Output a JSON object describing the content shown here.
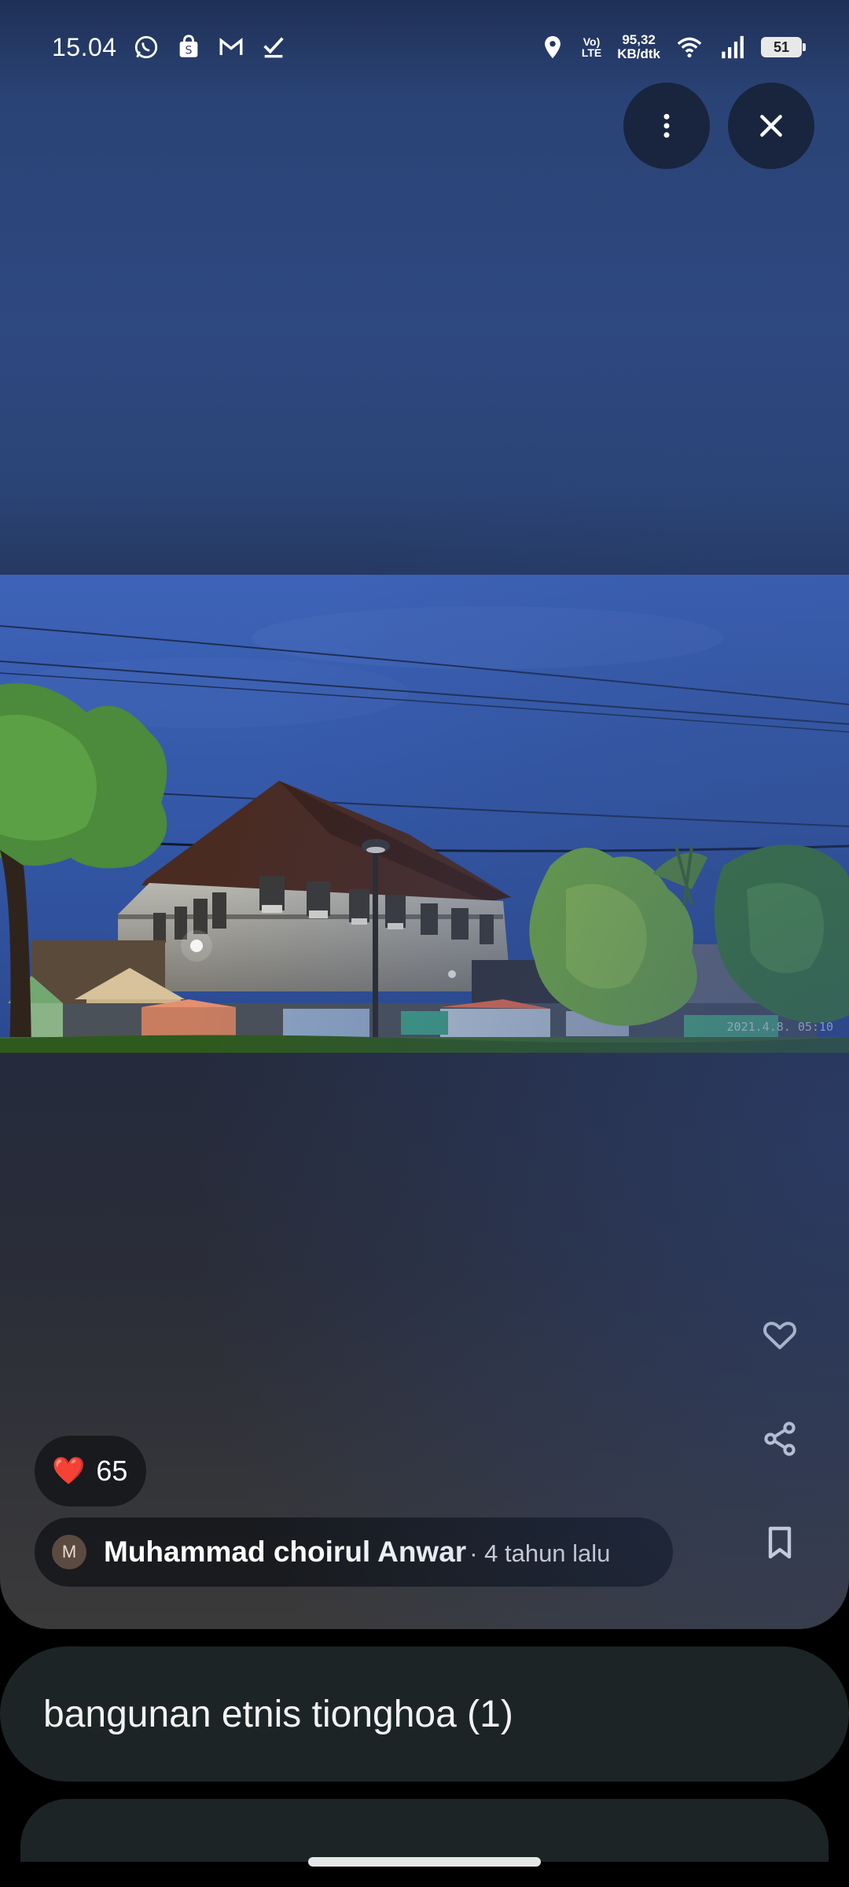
{
  "status_bar": {
    "time": "15.04",
    "network_speed_value": "95,32",
    "network_speed_unit": "KB/dtk",
    "volte": "Vo)",
    "lte": "LTE",
    "battery": "51",
    "icons": [
      "whatsapp-icon",
      "shopee-icon",
      "gmail-icon",
      "tasks-icon",
      "location-icon",
      "wifi-icon",
      "signal-icon",
      "battery-icon"
    ]
  },
  "toolbar": {
    "more_icon": "more-vertical-icon",
    "close_icon": "close-icon"
  },
  "photo": {
    "timestamp": "2021.4.8. 05:10"
  },
  "actions": {
    "like_icon": "heart-outline-icon",
    "share_icon": "share-icon",
    "save_icon": "bookmark-icon"
  },
  "likes": {
    "emoji": "❤️",
    "count": "65"
  },
  "author": {
    "initial": "M",
    "name": "Muhammad choirul Anwar",
    "time": "· 4 tahun lalu"
  },
  "album": {
    "title": "bangunan etnis tionghoa (1)"
  }
}
